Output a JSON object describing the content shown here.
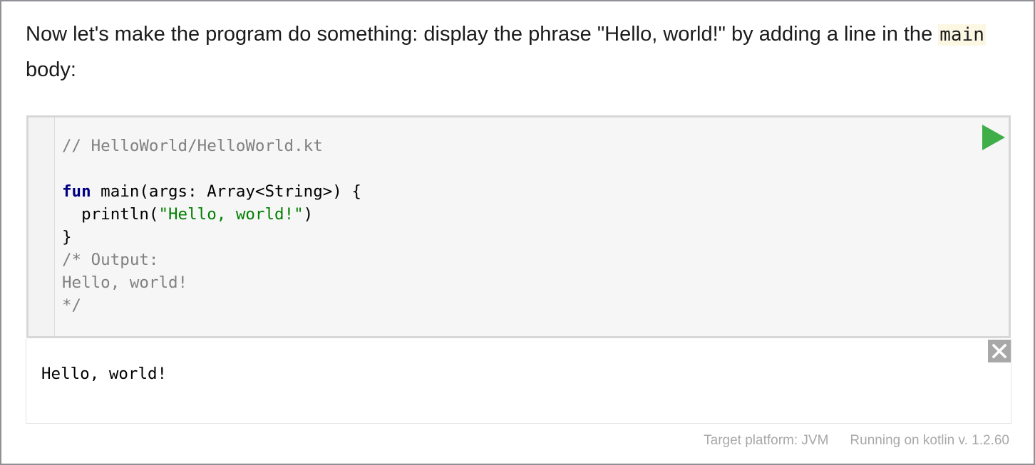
{
  "intro": {
    "text_before": "Now let's make the program do something: display the phrase \"Hello, world!\" by adding a line in the ",
    "inline_code": "main",
    "text_after": " body:"
  },
  "editor": {
    "lines": {
      "l1": "// HelloWorld/HelloWorld.kt",
      "l3_keyword": "fun",
      "l3_rest": " main(args: Array<String>) {",
      "l4_indent": "  ",
      "l4_call": "println(",
      "l4_string": "\"Hello, world!\"",
      "l4_close": ")",
      "l5": "}",
      "l6": "/* Output:",
      "l7": "Hello, world!",
      "l8": "*/"
    },
    "run_icon": "play-icon",
    "run_color": "#3fae49"
  },
  "output": {
    "text": "Hello, world!",
    "close_icon": "close-icon"
  },
  "footer": {
    "target_platform": "Target platform: JVM",
    "running_on": "Running on kotlin v. 1.2.60"
  }
}
